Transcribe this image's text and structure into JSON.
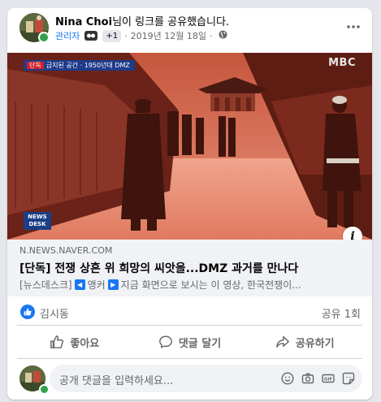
{
  "post": {
    "author": "Nina Choi",
    "action_text": "님이 링크를 공유했습니다.",
    "admin_badge": "관리자",
    "plus_badge": "+1",
    "date": "2019년 12월 18일",
    "separator": "·",
    "privacy_icon": "globe-icon",
    "more_icon": "more-dots-icon"
  },
  "video": {
    "caption_tag": "금지된 공간 · 1950년대 DMZ",
    "caption_prefix": "단독",
    "channel_logo": "MBC",
    "news_desk": "NEWS DESK",
    "info_label": "i"
  },
  "link": {
    "domain": "N.NEWS.NAVER.COM",
    "title": "[단독] 전쟁 상흔 위 희망의 씨앗을...DMZ 과거를 만나다",
    "desc_part1": "[뉴스데스크]",
    "desc_part2": "앵커",
    "desc_part3": "지금 화면으로 보시는 이 영상, 한국전쟁이..."
  },
  "reactions": {
    "names": "김시동",
    "shares": "공유 1회",
    "like_color": "#1877f2"
  },
  "actions": {
    "like": "좋아요",
    "comment": "댓글 달기",
    "share": "공유하기"
  },
  "comment_box": {
    "placeholder": "공개 댓글을 입력하세요..."
  }
}
